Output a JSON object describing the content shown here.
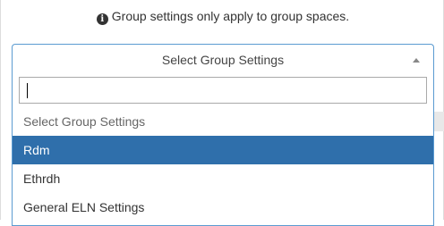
{
  "notice": {
    "icon": "info-circle-icon",
    "text": "Group settings only apply to group spaces."
  },
  "select": {
    "selected_label": "Select Group Settings",
    "caret_icon": "caret-up-icon",
    "search_value": "",
    "options": [
      {
        "label": "Select Group Settings",
        "state": "placeholder"
      },
      {
        "label": "Rdm",
        "state": "highlighted"
      },
      {
        "label": "Ethrdh",
        "state": "normal"
      },
      {
        "label": "General ELN Settings",
        "state": "normal"
      }
    ]
  },
  "colors": {
    "focus_border": "#5b9bd1",
    "highlight_bg": "#2f6fab",
    "highlight_text": "#ffffff"
  }
}
